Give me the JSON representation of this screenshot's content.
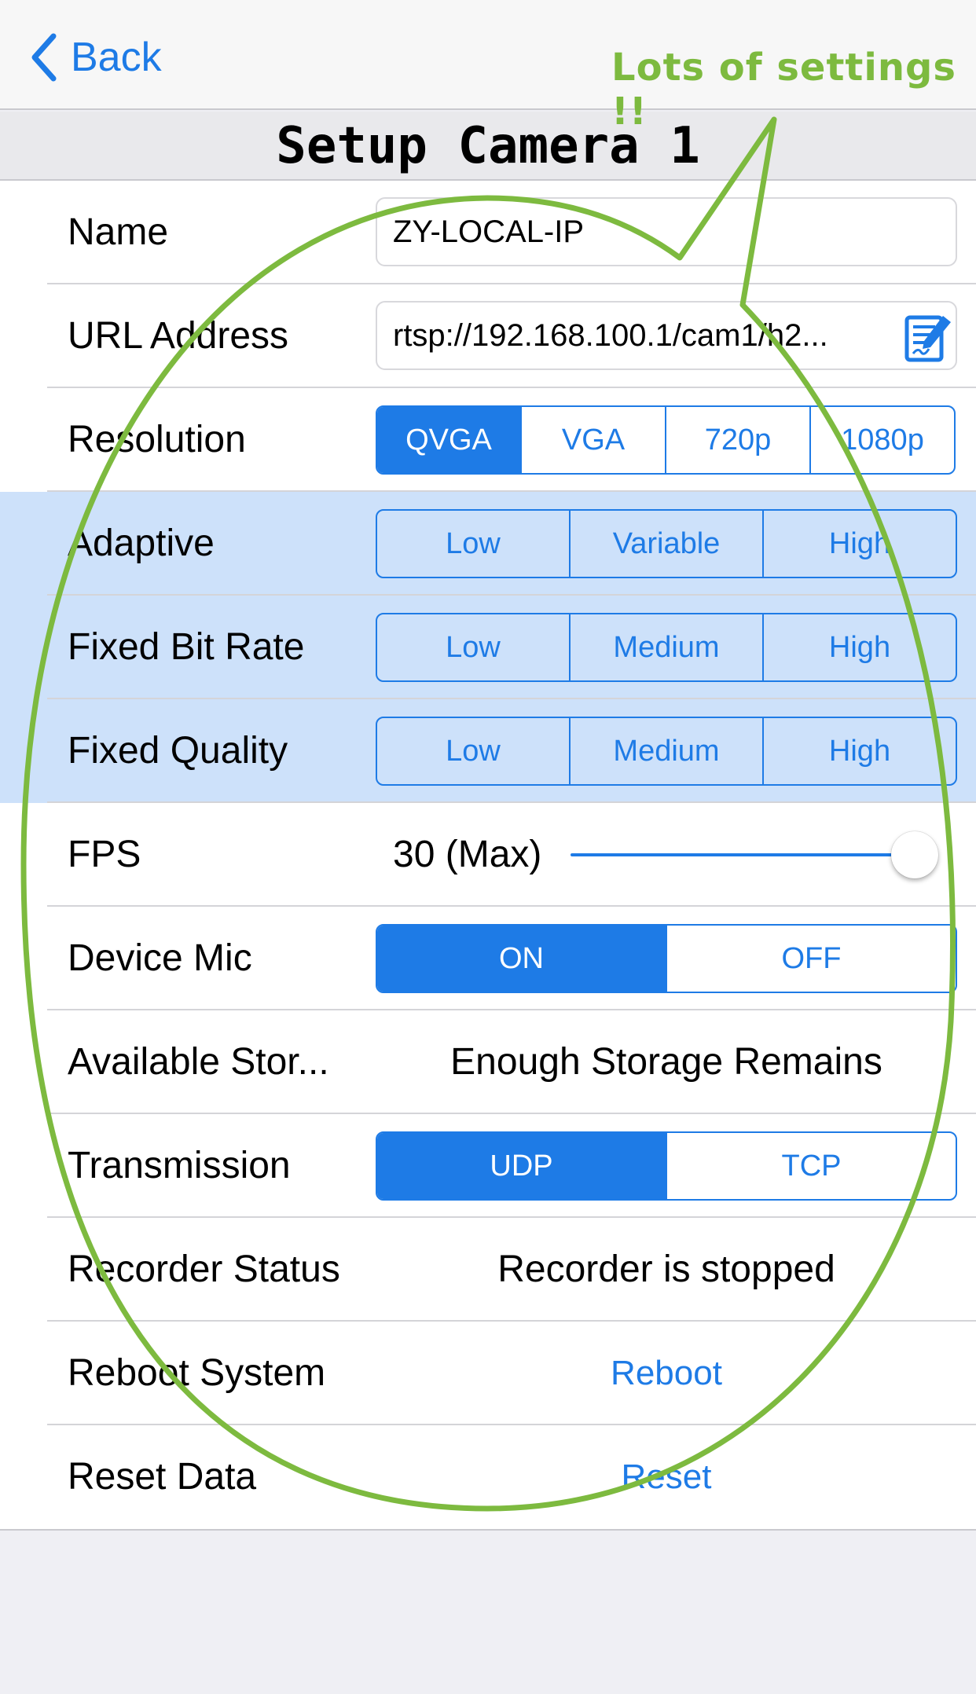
{
  "nav": {
    "back_label": "Back"
  },
  "annotation": {
    "text": "Lots of settings !!"
  },
  "title": "Setup Camera 1",
  "rows": {
    "name": {
      "label": "Name",
      "value": "ZY-LOCAL-IP"
    },
    "url": {
      "label": "URL Address",
      "value": "rtsp://192.168.100.1/cam1/h2..."
    },
    "resolution": {
      "label": "Resolution",
      "options": [
        "QVGA",
        "VGA",
        "720p",
        "1080p"
      ],
      "selected": "QVGA"
    },
    "adaptive": {
      "label": "Adaptive",
      "options": [
        "Low",
        "Variable",
        "High"
      ]
    },
    "bitrate": {
      "label": "Fixed Bit Rate",
      "options": [
        "Low",
        "Medium",
        "High"
      ]
    },
    "quality": {
      "label": "Fixed Quality",
      "options": [
        "Low",
        "Medium",
        "High"
      ]
    },
    "fps": {
      "label": "FPS",
      "value_text": "30 (Max)",
      "slider_fraction": 1.0
    },
    "mic": {
      "label": "Device Mic",
      "options": [
        "ON",
        "OFF"
      ],
      "selected": "ON"
    },
    "storage": {
      "label": "Available Stor...",
      "value": "Enough Storage Remains"
    },
    "transmission": {
      "label": "Transmission",
      "options": [
        "UDP",
        "TCP"
      ],
      "selected": "UDP"
    },
    "recorder": {
      "label": "Recorder Status",
      "value": "Recorder is stopped"
    },
    "reboot": {
      "label": "Reboot System",
      "action": "Reboot"
    },
    "reset": {
      "label": "Reset Data",
      "action": "Reset"
    }
  },
  "colors": {
    "accent": "#1e7be6",
    "highlight_rows": "#cde1fa",
    "annotation_green": "#7dba3f",
    "background": "#efeff4"
  },
  "icons": {
    "back": "chevron-left-icon",
    "url_edit": "edit-note-icon"
  }
}
